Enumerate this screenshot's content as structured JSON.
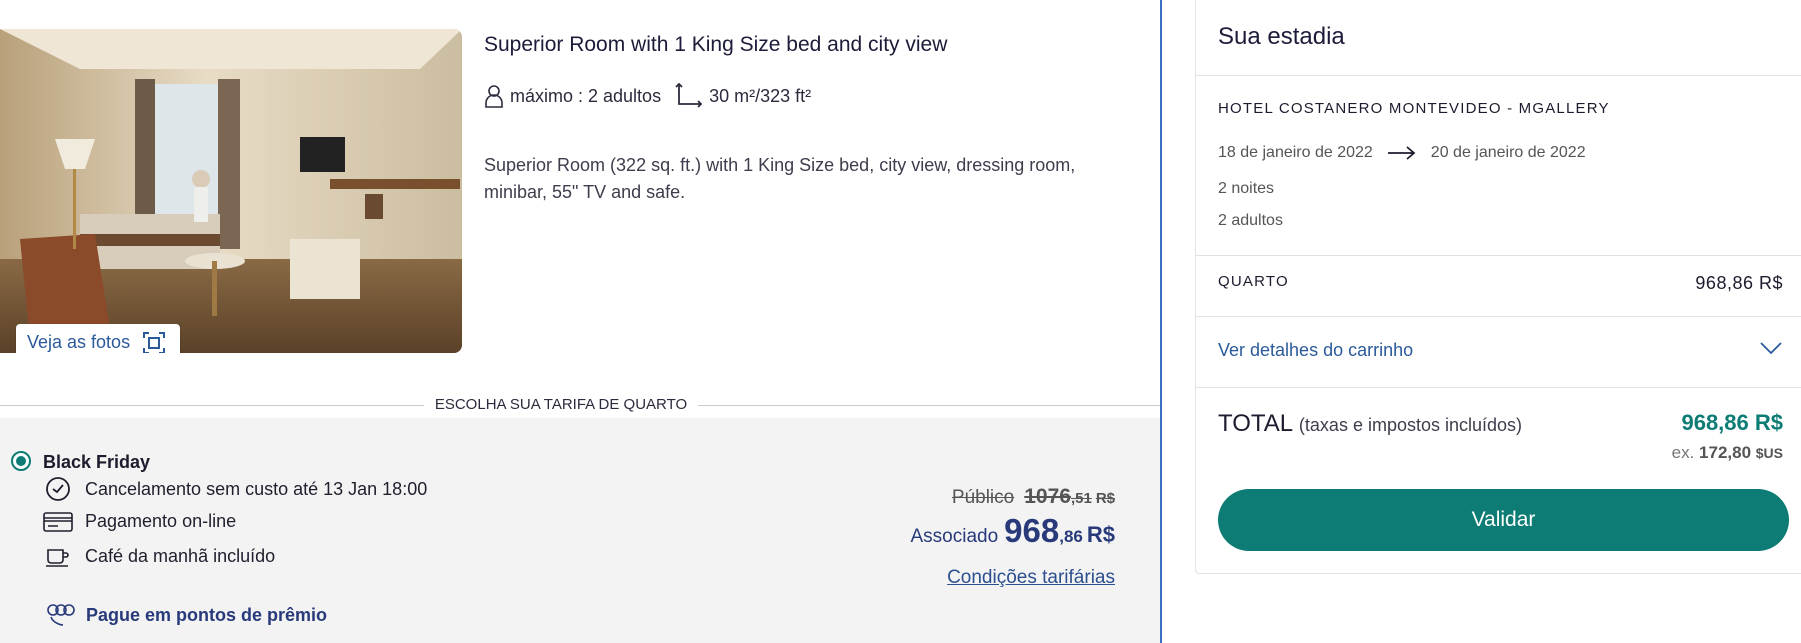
{
  "room": {
    "title": "Superior Room with 1 King Size bed and city view",
    "capacity": "máximo : 2 adultos",
    "size": "30 m²/323 ft²",
    "description": "Superior Room (322 sq. ft.) with 1 King Size bed, city view, dressing room, minibar, 55\" TV and safe.",
    "photos_label": "Veja as fotos",
    "icons": {
      "capacity": "person-icon",
      "size": "area-icon",
      "photos": "gallery-icon"
    }
  },
  "tariff": {
    "section_label": "ESCOLHA SUA TARIFA DE QUARTO",
    "rate_name": "Black Friday",
    "features": [
      {
        "icon": "clock-icon",
        "label": "Cancelamento sem custo até 13 Jan 18:00"
      },
      {
        "icon": "credit-card-icon",
        "label": "Pagamento on-line"
      },
      {
        "icon": "coffee-cup-icon",
        "label": "Café da manhã incluído"
      }
    ],
    "points_label": "Pague em pontos de prêmio",
    "public_label": "Público",
    "public_price_int": "1076",
    "public_price_dec": ",51",
    "public_currency": "R$",
    "member_label": "Associado",
    "member_price_int": "968",
    "member_price_dec": ",86",
    "member_currency": "R$",
    "conditions_link": "Condições tarifárias"
  },
  "summary": {
    "title": "Sua estadia",
    "hotel": "HOTEL COSTANERO MONTEVIDEO - MGALLERY",
    "checkin": "18 de janeiro de 2022",
    "checkout": "20 de janeiro de 2022",
    "nights": "2 noites",
    "adults": "2 adultos",
    "room_label": "QUARTO",
    "room_price": "968,86 R$",
    "details_link": "Ver detalhes do carrinho",
    "total_label": "TOTAL",
    "total_sub": "(taxas e impostos incluídos)",
    "total_price": "968,86 R$",
    "usd_prefix": "ex.",
    "usd_value": "172,80",
    "usd_currency": "$US",
    "validate_label": "Validar"
  },
  "colors": {
    "accent": "#0c7c74",
    "member_price": "#283a7a",
    "link": "#2b5a9a",
    "divider": "#3b6fc4"
  }
}
